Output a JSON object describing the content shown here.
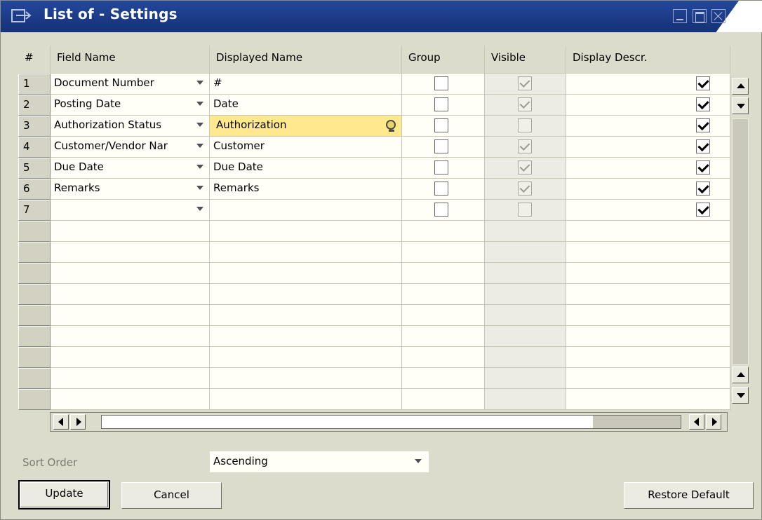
{
  "window": {
    "title": "List of - Settings"
  },
  "grid": {
    "headers": [
      "#",
      "Field Name",
      "Displayed Name",
      "Group",
      "Visible",
      "Display Descr."
    ],
    "rows": [
      {
        "num": "1",
        "field": "Document Number",
        "display": "#",
        "group": false,
        "visible": true,
        "descr": true
      },
      {
        "num": "2",
        "field": "Posting Date",
        "display": "Date",
        "group": false,
        "visible": true,
        "descr": true
      },
      {
        "num": "3",
        "field": "Authorization Status",
        "display": "Authorization",
        "group": false,
        "visible": false,
        "descr": true
      },
      {
        "num": "4",
        "field": "Customer/Vendor Nar",
        "display": "Customer",
        "group": false,
        "visible": true,
        "descr": true
      },
      {
        "num": "5",
        "field": "Due Date",
        "display": "Due Date",
        "group": false,
        "visible": true,
        "descr": true
      },
      {
        "num": "6",
        "field": "Remarks",
        "display": "Remarks",
        "group": false,
        "visible": true,
        "descr": true
      },
      {
        "num": "7",
        "field": "",
        "display": "",
        "group": false,
        "visible": false,
        "descr": true
      }
    ],
    "empty_rows": 9
  },
  "sort": {
    "label": "Sort Order",
    "value": "Ascending"
  },
  "buttons": {
    "update": "Update",
    "cancel": "Cancel",
    "restore": "Restore Default"
  }
}
